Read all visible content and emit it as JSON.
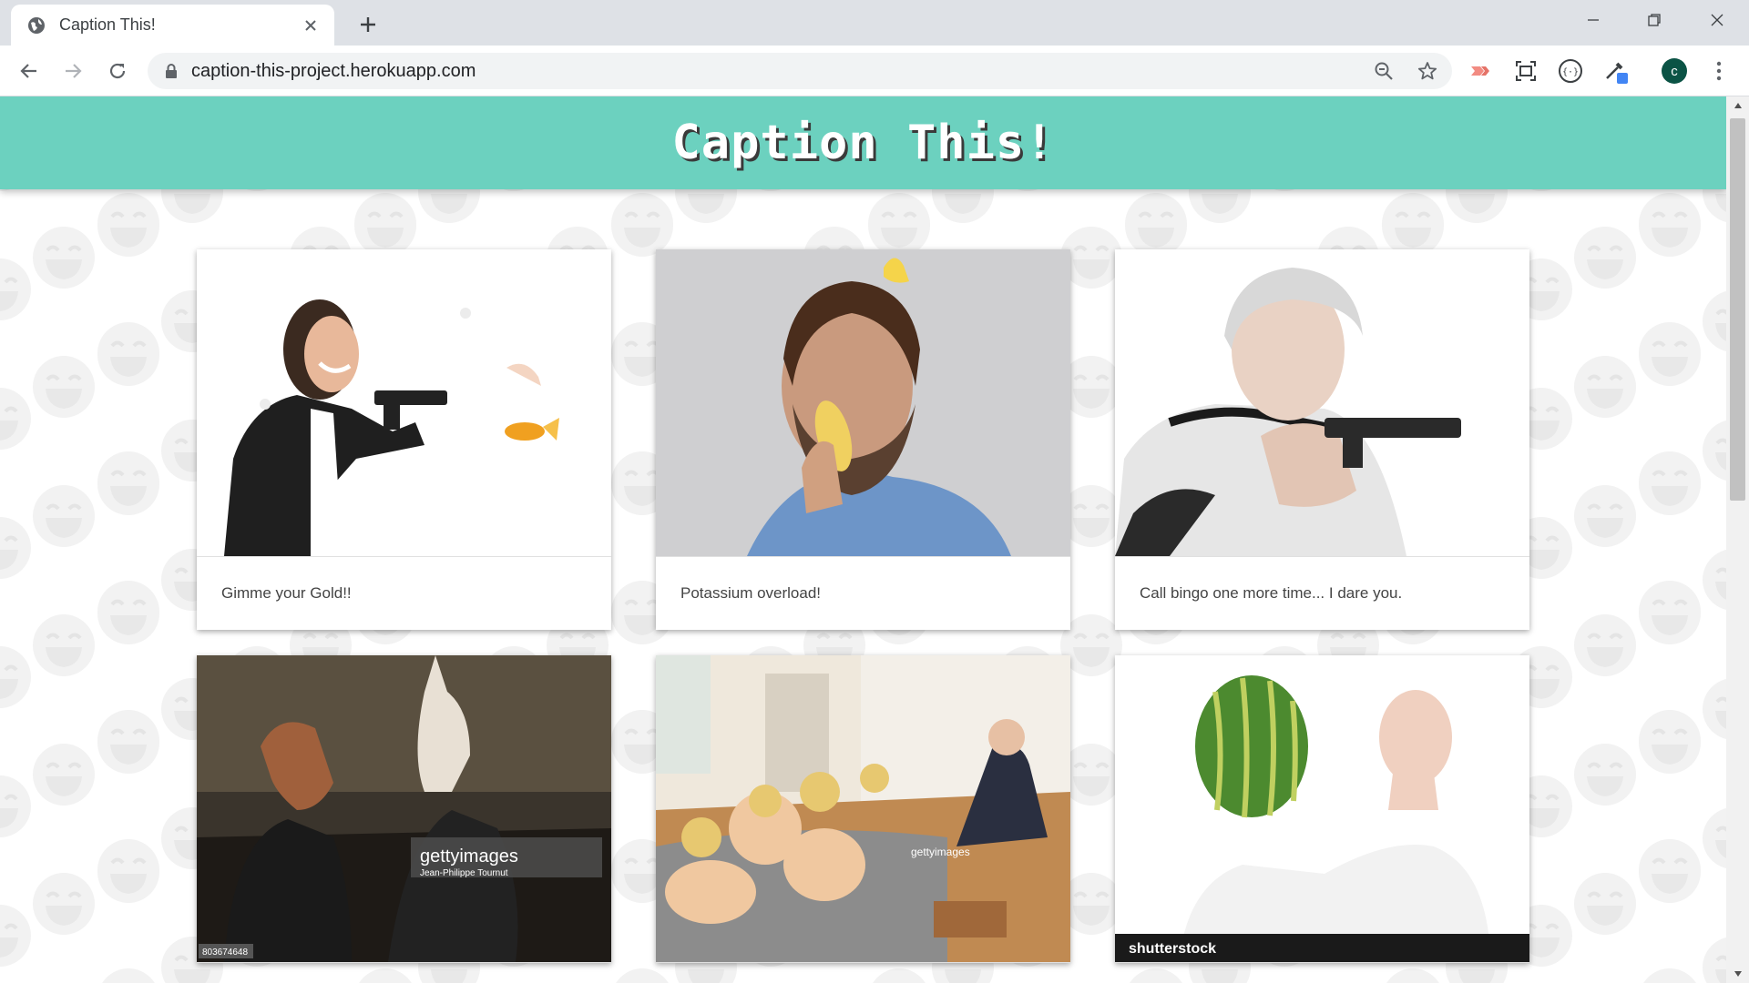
{
  "browser": {
    "tab_title": "Caption This!",
    "url": "caption-this-project.herokuapp.com",
    "profile_initial": "C"
  },
  "site": {
    "title": "Caption This!",
    "accent_color": "#6cd1bf"
  },
  "cards": [
    {
      "caption": "Gimme your Gold!!",
      "image": "woman-with-gun-and-goldfish-photo"
    },
    {
      "caption": "Potassium overload!",
      "image": "man-eating-banana-photo"
    },
    {
      "caption": "Call bingo one more time... I dare you.",
      "image": "old-woman-with-gun-photo"
    },
    {
      "caption": "",
      "image": "horse-and-rabbit-masks-photo",
      "watermark": "gettyimages",
      "watermark_credit": "Jean-Philippe Tournut",
      "image_id": "803674648"
    },
    {
      "caption": "",
      "image": "children-on-floor-photo",
      "watermark": "gettyimages"
    },
    {
      "caption": "",
      "image": "man-with-watermelon-photo",
      "watermark": "shutterstock"
    }
  ]
}
